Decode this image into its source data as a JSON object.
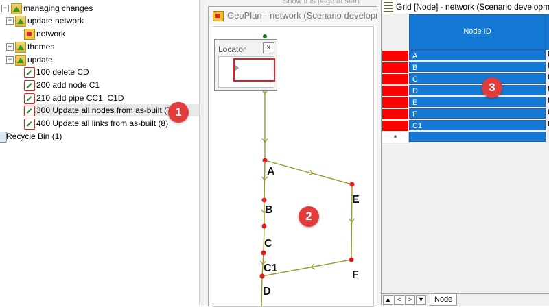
{
  "tree": {
    "items": [
      {
        "label": "managing changes"
      },
      {
        "label": "update network"
      },
      {
        "label": "network"
      },
      {
        "label": "themes"
      },
      {
        "label": "update"
      },
      {
        "label": "100 delete CD"
      },
      {
        "label": "200 add node C1"
      },
      {
        "label": "210 add pipe CC1, C1D"
      },
      {
        "label": "300 Update all nodes from as-built (7)"
      },
      {
        "label": "400 Update all links from as-built (8)"
      },
      {
        "label": "Recycle Bin (1)"
      }
    ],
    "expanders": [
      "−",
      "−",
      "+",
      "−"
    ]
  },
  "badges": [
    "1",
    "2",
    "3"
  ],
  "geoplan": {
    "title": "GeoPlan - network (Scenario development)",
    "behind_text": "Show this page at start",
    "locator_title": "Locator",
    "locator_close": "x",
    "node_labels": [
      "A",
      "B",
      "C",
      "C1",
      "D",
      "E",
      "F"
    ]
  },
  "grid": {
    "title": "Grid [Node] - network (Scenario development)",
    "column_header": "Node ID",
    "rows": [
      "A",
      "B",
      "C",
      "D",
      "E",
      "F",
      "C1"
    ],
    "row_suffix": "N",
    "new_row_marker": "*",
    "tab_label": "Node",
    "nav": [
      "▲",
      "<",
      ">",
      "▼"
    ]
  },
  "colors": {
    "link": "#9a9a2a",
    "node": "#e01b1b",
    "grid_cell": "#1479d4",
    "row_header": "#ff0000",
    "badge": "#e23b3b"
  }
}
